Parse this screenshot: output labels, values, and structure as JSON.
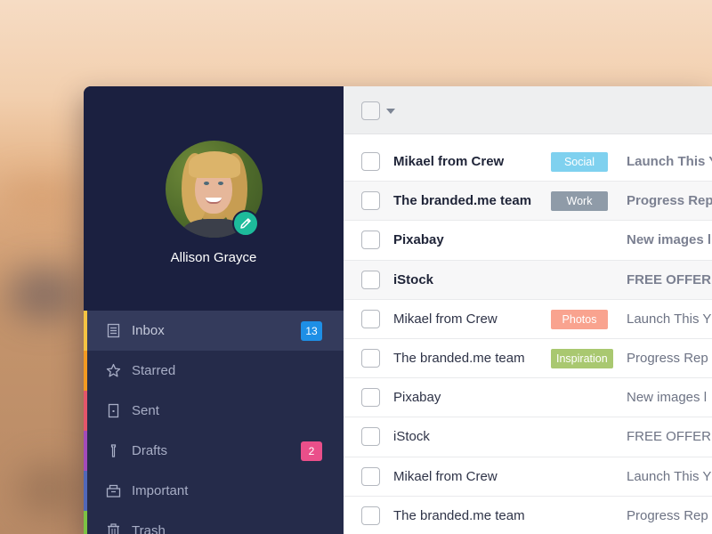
{
  "profile": {
    "name": "Allison Grayce",
    "avatar_icon": "user-photo",
    "edit_icon": "pencil-icon"
  },
  "nav": [
    {
      "label": "Inbox",
      "icon": "inbox-icon",
      "color": "#f5c342",
      "badge": "13",
      "badge_color": "#1e8fe6",
      "active": true
    },
    {
      "label": "Starred",
      "icon": "star-icon",
      "color": "#f39a21",
      "badge": "",
      "badge_color": "",
      "active": false
    },
    {
      "label": "Sent",
      "icon": "sent-icon",
      "color": "#e4556a",
      "badge": "",
      "badge_color": "",
      "active": false
    },
    {
      "label": "Drafts",
      "icon": "drafts-icon",
      "color": "#a34bb9",
      "badge": "2",
      "badge_color": "#ea4f8a",
      "active": false
    },
    {
      "label": "Important",
      "icon": "important-icon",
      "color": "#5168b8",
      "badge": "",
      "badge_color": "",
      "active": false
    },
    {
      "label": "Trash",
      "icon": "trash-icon",
      "color": "#7cc243",
      "badge": "",
      "badge_color": "",
      "active": false
    }
  ],
  "toolbar": {
    "select_all_icon": "checkbox-icon",
    "dropdown_icon": "caret-down-icon"
  },
  "emails": [
    {
      "sender": "Mikael from Crew",
      "tag": "Social",
      "tag_color": "#7fd1ef",
      "subject": "Launch This Y",
      "unread": true
    },
    {
      "sender": "The branded.me team",
      "tag": "Work",
      "tag_color": "#8f9ba8",
      "subject": "Progress Rep",
      "unread": true
    },
    {
      "sender": "Pixabay",
      "tag": "",
      "tag_color": "",
      "subject": "New images l",
      "unread": true
    },
    {
      "sender": "iStock",
      "tag": "",
      "tag_color": "",
      "subject": "FREE OFFER:",
      "unread": true
    },
    {
      "sender": "Mikael from Crew",
      "tag": "Photos",
      "tag_color": "#f9a38f",
      "subject": "Launch This Y",
      "unread": false
    },
    {
      "sender": "The branded.me team",
      "tag": "Inspiration",
      "tag_color": "#a9c870",
      "subject": "Progress Rep",
      "unread": false
    },
    {
      "sender": "Pixabay",
      "tag": "",
      "tag_color": "",
      "subject": "New images l",
      "unread": false
    },
    {
      "sender": "iStock",
      "tag": "",
      "tag_color": "",
      "subject": "FREE OFFER:",
      "unread": false
    },
    {
      "sender": "Mikael from Crew",
      "tag": "",
      "tag_color": "",
      "subject": "Launch This Y",
      "unread": false
    },
    {
      "sender": "The branded.me team",
      "tag": "",
      "tag_color": "",
      "subject": "Progress Rep",
      "unread": false
    }
  ]
}
